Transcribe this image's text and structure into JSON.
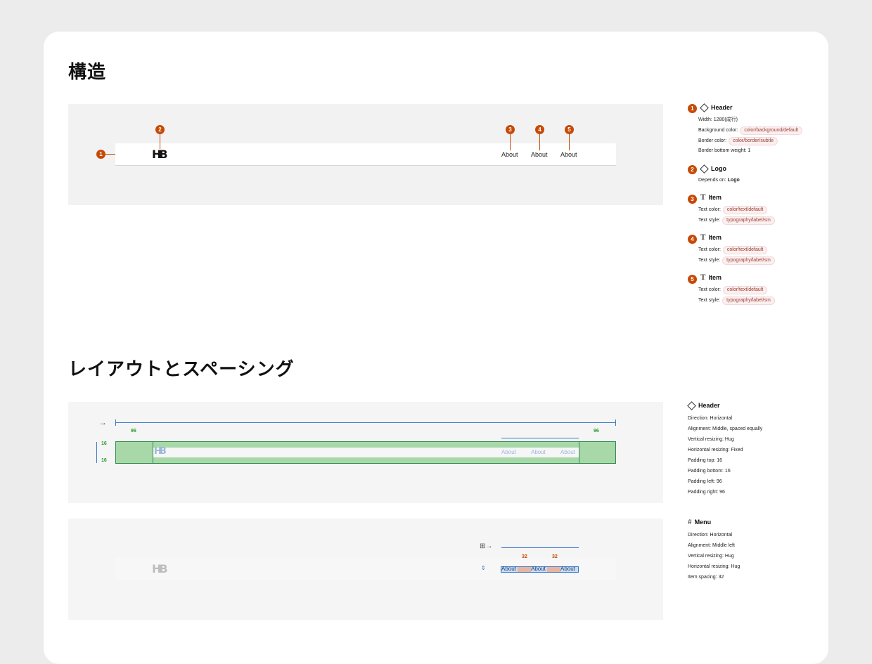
{
  "section_structure": {
    "title": "構造"
  },
  "section_layout": {
    "title": "レイアウトとスペーシング"
  },
  "preview": {
    "logo": "HB",
    "nav_items": [
      "About",
      "About",
      "About"
    ]
  },
  "badges": [
    "1",
    "2",
    "3",
    "4",
    "5"
  ],
  "structure_specs": [
    {
      "num": "1",
      "icon": "diamond-icon",
      "title": "Header",
      "lines": [
        {
          "label": "Width: 1280(成行)",
          "chip": ""
        },
        {
          "label": "Background color:",
          "chip": "color/background/default"
        },
        {
          "label": "Border color:",
          "chip": "color/border/subtle"
        },
        {
          "label": "Border bottom weight: 1",
          "chip": ""
        }
      ]
    },
    {
      "num": "2",
      "icon": "diamond-icon",
      "title": "Logo",
      "lines": [
        {
          "label": "Depends on:",
          "bold": "Logo"
        }
      ]
    },
    {
      "num": "3",
      "icon": "text-icon",
      "title": "Item",
      "lines": [
        {
          "label": "Text color:",
          "chip": "color/text/default"
        },
        {
          "label": "Text style:",
          "chip": "typography/label/sm"
        }
      ]
    },
    {
      "num": "4",
      "icon": "text-icon",
      "title": "Item",
      "lines": [
        {
          "label": "Text color:",
          "chip": "color/text/default"
        },
        {
          "label": "Text style:",
          "chip": "typography/label/sm"
        }
      ]
    },
    {
      "num": "5",
      "icon": "text-icon",
      "title": "Item",
      "lines": [
        {
          "label": "Text color:",
          "chip": "color/text/default"
        },
        {
          "label": "Text style:",
          "chip": "typography/label/sm"
        }
      ]
    }
  ],
  "header_layout": {
    "title": "Header",
    "lines": [
      "Direction: Horizontal",
      "Alignment: Middle, spaced equally",
      "Vertical resizing: Hug",
      "Horizontal resizing: Fixed",
      "Padding top: 16",
      "Padding bottom: 16",
      "Padding left: 96",
      "Padding right: 96"
    ],
    "pad_left": "96",
    "pad_right": "96",
    "pad_top": "16",
    "pad_bottom": "16"
  },
  "menu_layout": {
    "title": "Menu",
    "lines": [
      "Direction: Horizontal",
      "Alignment: Middle left",
      "Vertical resizing: Hug",
      "Horizontal resizing: Hug",
      "Item spacing: 32"
    ],
    "gap1": "32",
    "gap2": "32"
  },
  "colors": {
    "accent": "#c64a06",
    "padding_green": "#a8d8a8",
    "gap_orange": "#e8b4a0",
    "guide_blue": "#3a78c9"
  }
}
